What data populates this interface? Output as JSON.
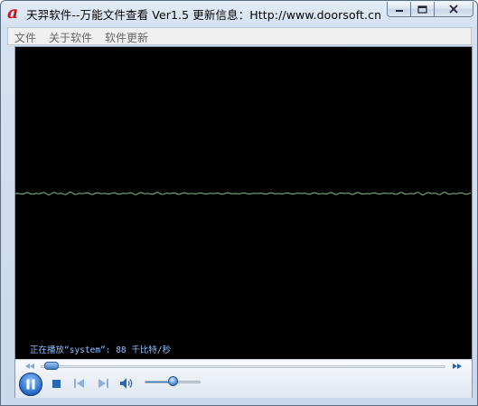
{
  "window": {
    "title": "天羿软件--万能文件查看 Ver1.5  更新信息：Http://www.doorsoft.cn",
    "icon": "app-logo-a-icon"
  },
  "menu": {
    "items": [
      {
        "label": "文件"
      },
      {
        "label": "关于软件"
      },
      {
        "label": "软件更新"
      }
    ]
  },
  "player": {
    "status_text": "正在播放“system”: 88 千比特/秒",
    "seek_progress": 0.01,
    "volume_level": 0.5,
    "waveform_color": "#7cc27c",
    "accent_color": "#2469c6"
  }
}
